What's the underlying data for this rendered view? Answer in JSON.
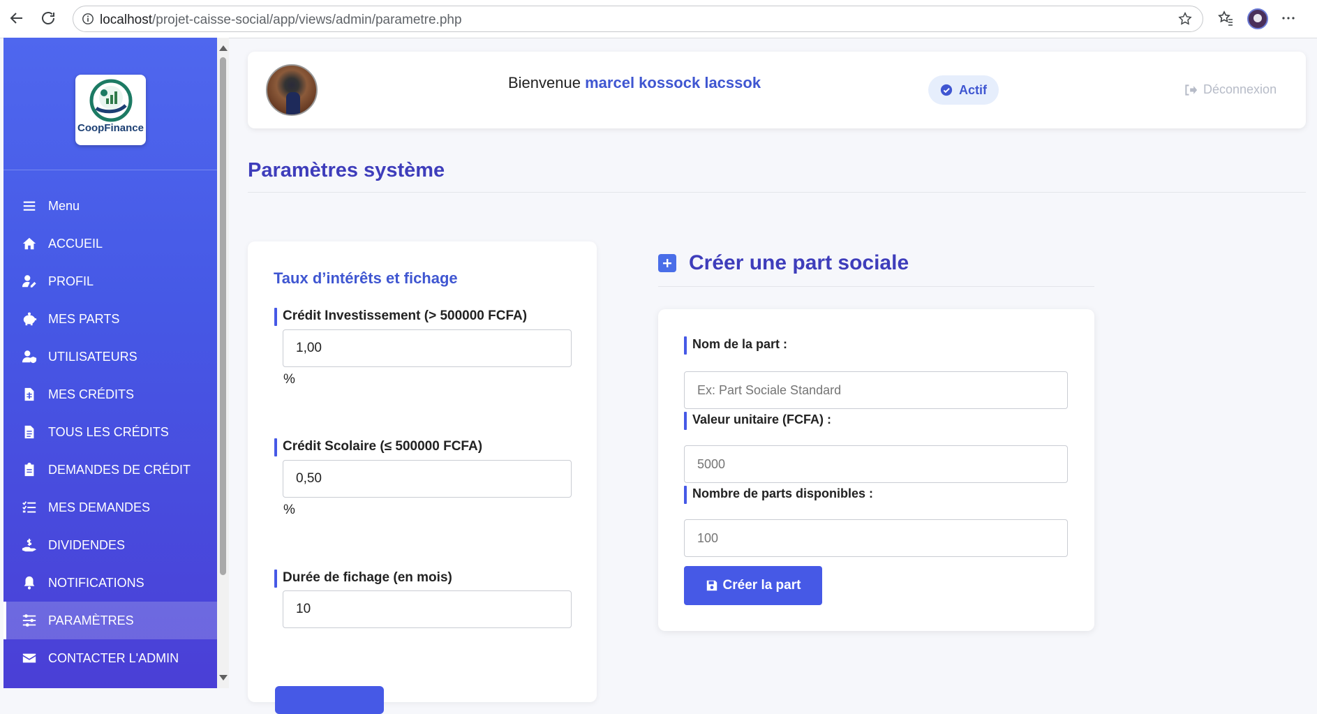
{
  "browser": {
    "url_host": "localhost",
    "url_path": "/projet-caisse-social/app/views/admin/parametre.php"
  },
  "sidebar": {
    "logo_text": "CoopFinance",
    "items": [
      {
        "label": "Menu",
        "icon": "bars-icon"
      },
      {
        "label": "ACCUEIL",
        "icon": "home-icon"
      },
      {
        "label": "PROFIL",
        "icon": "user-edit-icon"
      },
      {
        "label": "MES PARTS",
        "icon": "piggy-bank-icon"
      },
      {
        "label": "UTILISATEURS",
        "icon": "users-shield-icon"
      },
      {
        "label": "MES CRÉDITS",
        "icon": "file-invoice-dollar-icon"
      },
      {
        "label": "TOUS LES CRÉDITS",
        "icon": "file-alt-icon"
      },
      {
        "label": "DEMANDES DE CRÉDIT",
        "icon": "clipboard-icon"
      },
      {
        "label": "MES DEMANDES",
        "icon": "tasks-icon"
      },
      {
        "label": "DIVIDENDES",
        "icon": "hand-holding-dollar-icon"
      },
      {
        "label": "NOTIFICATIONS",
        "icon": "bell-icon"
      },
      {
        "label": "PARAMÈTRES",
        "icon": "sliders-icon",
        "active": true
      },
      {
        "label": "CONTACTER L'ADMIN",
        "icon": "envelope-icon"
      }
    ]
  },
  "header": {
    "welcome_prefix": "Bienvenue",
    "user_name": "marcel kossock lacssok",
    "status": "Actif",
    "logout": "Déconnexion"
  },
  "page": {
    "title": "Paramètres système"
  },
  "rates_card": {
    "title": "Taux d’intérêts et fichage",
    "fields": [
      {
        "label": "Crédit Investissement (> 500000 FCFA)",
        "value": "1,00",
        "unit": "%"
      },
      {
        "label": "Crédit Scolaire (≤ 500000 FCFA)",
        "value": "0,50",
        "unit": "%"
      },
      {
        "label": "Durée de fichage (en mois)",
        "value": "10"
      }
    ]
  },
  "part_form": {
    "title": "Créer une part sociale",
    "fields": [
      {
        "label": "Nom de la part :",
        "placeholder": "Ex: Part Sociale Standard"
      },
      {
        "label": "Valeur unitaire (FCFA) :",
        "placeholder": "5000"
      },
      {
        "label": "Nombre de parts disponibles :",
        "placeholder": "100"
      }
    ],
    "submit_label": "Créer la part"
  },
  "colors": {
    "accent": "#4659e6",
    "title": "#3e3dbb",
    "sidebar_top": "#4f67ee",
    "sidebar_bottom": "#4a3fd6"
  }
}
